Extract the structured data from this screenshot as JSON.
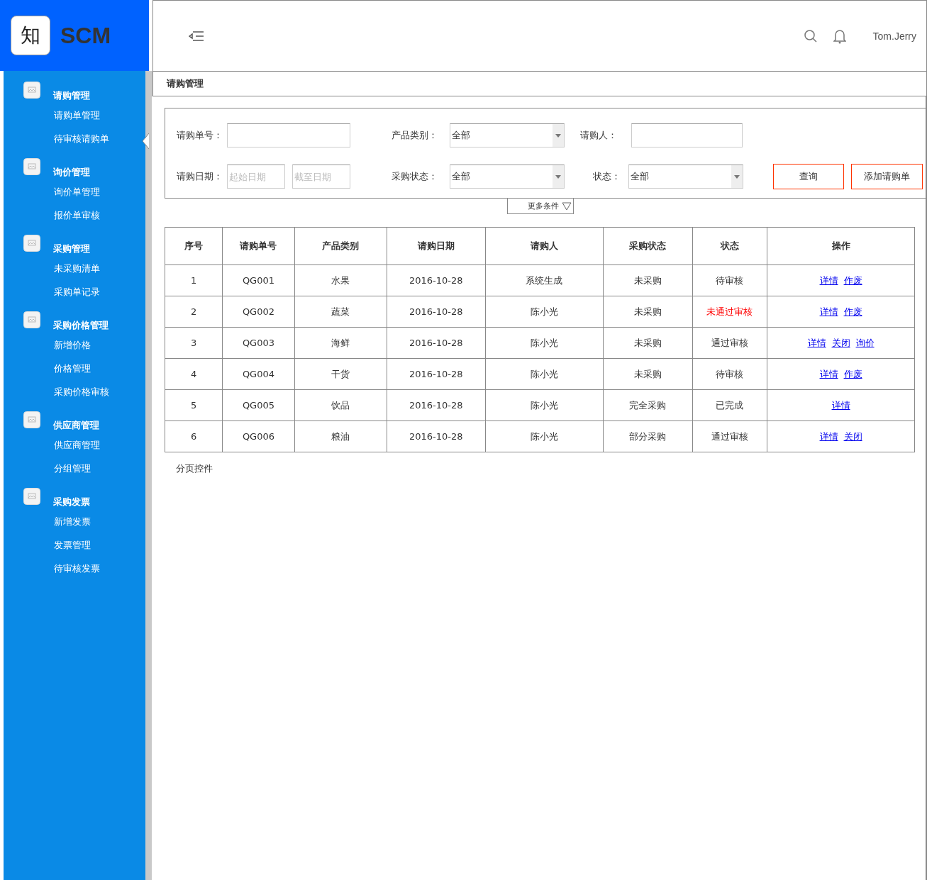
{
  "logo": {
    "mark": "知",
    "name": "SCM"
  },
  "header": {
    "user": "Tom.Jerry"
  },
  "sidebar": {
    "groups": [
      {
        "title": "请购管理",
        "items": [
          "请购单管理",
          "待审核请购单"
        ]
      },
      {
        "title": "询价管理",
        "items": [
          "询价单管理",
          "报价单审核"
        ]
      },
      {
        "title": "采购管理",
        "items": [
          "未采购清单",
          "采购单记录"
        ]
      },
      {
        "title": "采购价格管理",
        "items": [
          "新增价格",
          "价格管理",
          "采购价格审核"
        ]
      },
      {
        "title": "供应商管理",
        "items": [
          "供应商管理",
          "分组管理"
        ]
      },
      {
        "title": "采购发票",
        "items": [
          "新增发票",
          "发票管理",
          "待审核发票"
        ]
      }
    ]
  },
  "breadcrumb": "请购管理",
  "filters": {
    "order_no": {
      "label": "请购单号："
    },
    "category": {
      "label": "产品类别：",
      "value": "全部"
    },
    "requester": {
      "label": "请购人："
    },
    "date": {
      "label": "请购日期：",
      "start_placeholder": "起始日期",
      "end_placeholder": "截至日期"
    },
    "purchase_status": {
      "label": "采购状态：",
      "value": "全部"
    },
    "status": {
      "label": "状态：",
      "value": "全部"
    },
    "buttons": [
      "查询",
      "添加请购单"
    ],
    "more": "更多条件"
  },
  "table": {
    "columns": [
      "序号",
      "请购单号",
      "产品类别",
      "请购日期",
      "请购人",
      "采购状态",
      "状态",
      "操作"
    ],
    "rows": [
      {
        "cells": [
          "1",
          "QG001",
          "水果",
          "2016-10-28",
          "系统生成",
          "未采购"
        ],
        "status": {
          "text": "待审核",
          "alert": false
        },
        "actions": [
          "详情",
          "作废"
        ]
      },
      {
        "cells": [
          "2",
          "QG002",
          "蔬菜",
          "2016-10-28",
          "陈小光",
          "未采购"
        ],
        "status": {
          "text": "未通过审核",
          "alert": true
        },
        "actions": [
          "详情",
          "作废"
        ]
      },
      {
        "cells": [
          "3",
          "QG003",
          "海鲜",
          "2016-10-28",
          "陈小光",
          "未采购"
        ],
        "status": {
          "text": "通过审核",
          "alert": false
        },
        "actions": [
          "详情",
          "关闭",
          "询价"
        ]
      },
      {
        "cells": [
          "4",
          "QG004",
          "干货",
          "2016-10-28",
          "陈小光",
          "未采购"
        ],
        "status": {
          "text": "待审核",
          "alert": false
        },
        "actions": [
          "详情",
          "作废"
        ]
      },
      {
        "cells": [
          "5",
          "QG005",
          "饮品",
          "2016-10-28",
          "陈小光",
          "完全采购"
        ],
        "status": {
          "text": "已完成",
          "alert": false
        },
        "actions": [
          "详情"
        ]
      },
      {
        "cells": [
          "6",
          "QG006",
          "粮油",
          "2016-10-28",
          "陈小光",
          "部分采购"
        ],
        "status": {
          "text": "通过审核",
          "alert": false
        },
        "actions": [
          "详情",
          "关闭"
        ]
      }
    ]
  },
  "pagination": "分页控件"
}
